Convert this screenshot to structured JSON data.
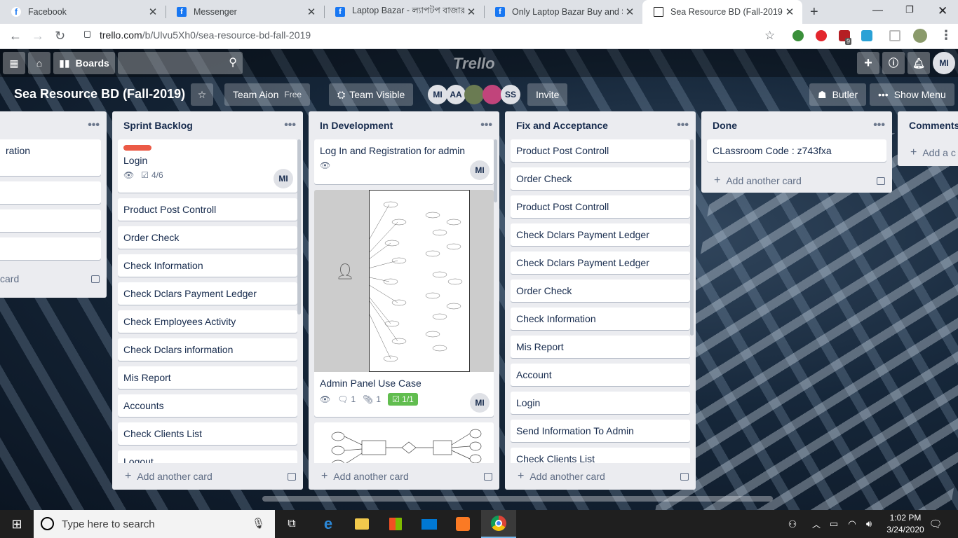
{
  "browser": {
    "tabs": [
      {
        "title": "Facebook",
        "icon": "facebook-icon"
      },
      {
        "title": "Messenger",
        "icon": "facebook-icon"
      },
      {
        "title": "Laptop Bazar - ল্যাপটপ বাজার",
        "icon": "facebook-icon"
      },
      {
        "title": "Only Laptop Bazar Buy and Sel",
        "icon": "facebook-icon"
      },
      {
        "title": "Sea Resource BD (Fall-2019) | T",
        "icon": "trello-icon",
        "active": true
      }
    ],
    "url_host": "trello.com",
    "url_path": "/b/Ulvu5Xh0/sea-resource-bd-fall-2019",
    "ext_badge": "9"
  },
  "trello": {
    "boards_label": "Boards",
    "logo": "Trello",
    "user_initials": "MI",
    "board_title": "Sea Resource BD (Fall-2019)",
    "team": "Team Aion",
    "team_plan": "Free",
    "visibility": "Team Visible",
    "members": [
      "MI",
      "AA",
      "",
      "",
      "SS"
    ],
    "invite": "Invite",
    "butler": "Butler",
    "show_menu": "Show Menu",
    "add_card": "Add another card",
    "lists": [
      {
        "title": "",
        "cards": [
          "ration",
          "",
          "",
          ""
        ],
        "add": "card"
      },
      {
        "title": "Sprint Backlog",
        "cards": [
          "Login",
          "Product Post Controll",
          "Order Check",
          "Check Information",
          "Check Dclars Payment Ledger",
          "Check Employees Activity",
          "Check Dclars information",
          "Mis Report",
          "Accounts",
          "Check Clients List",
          "Logout"
        ],
        "login_checklist": "4/6"
      },
      {
        "title": "In Development",
        "cards": [
          "Log In and Registration for admin",
          "Admin Panel Use Case",
          ""
        ],
        "usecase_comments": "1",
        "usecase_attach": "1",
        "usecase_checklist": "1/1"
      },
      {
        "title": "Fix and Acceptance",
        "cards": [
          "Product Post Controll",
          "Order Check",
          "Product Post Controll",
          "Check Dclars Payment Ledger",
          "Check Dclars Payment Ledger",
          "Order Check",
          "Check Information",
          "Mis Report",
          "Account",
          "Login",
          "Send Information To Admin",
          "Check Clients List"
        ]
      },
      {
        "title": "Done",
        "cards": [
          "CLassroom Code : z743fxa"
        ]
      },
      {
        "title": "Comments",
        "add": "Add a c"
      }
    ]
  },
  "taskbar": {
    "search_placeholder": "Type here to search",
    "time": "1:02 PM",
    "date": "3/24/2020"
  }
}
